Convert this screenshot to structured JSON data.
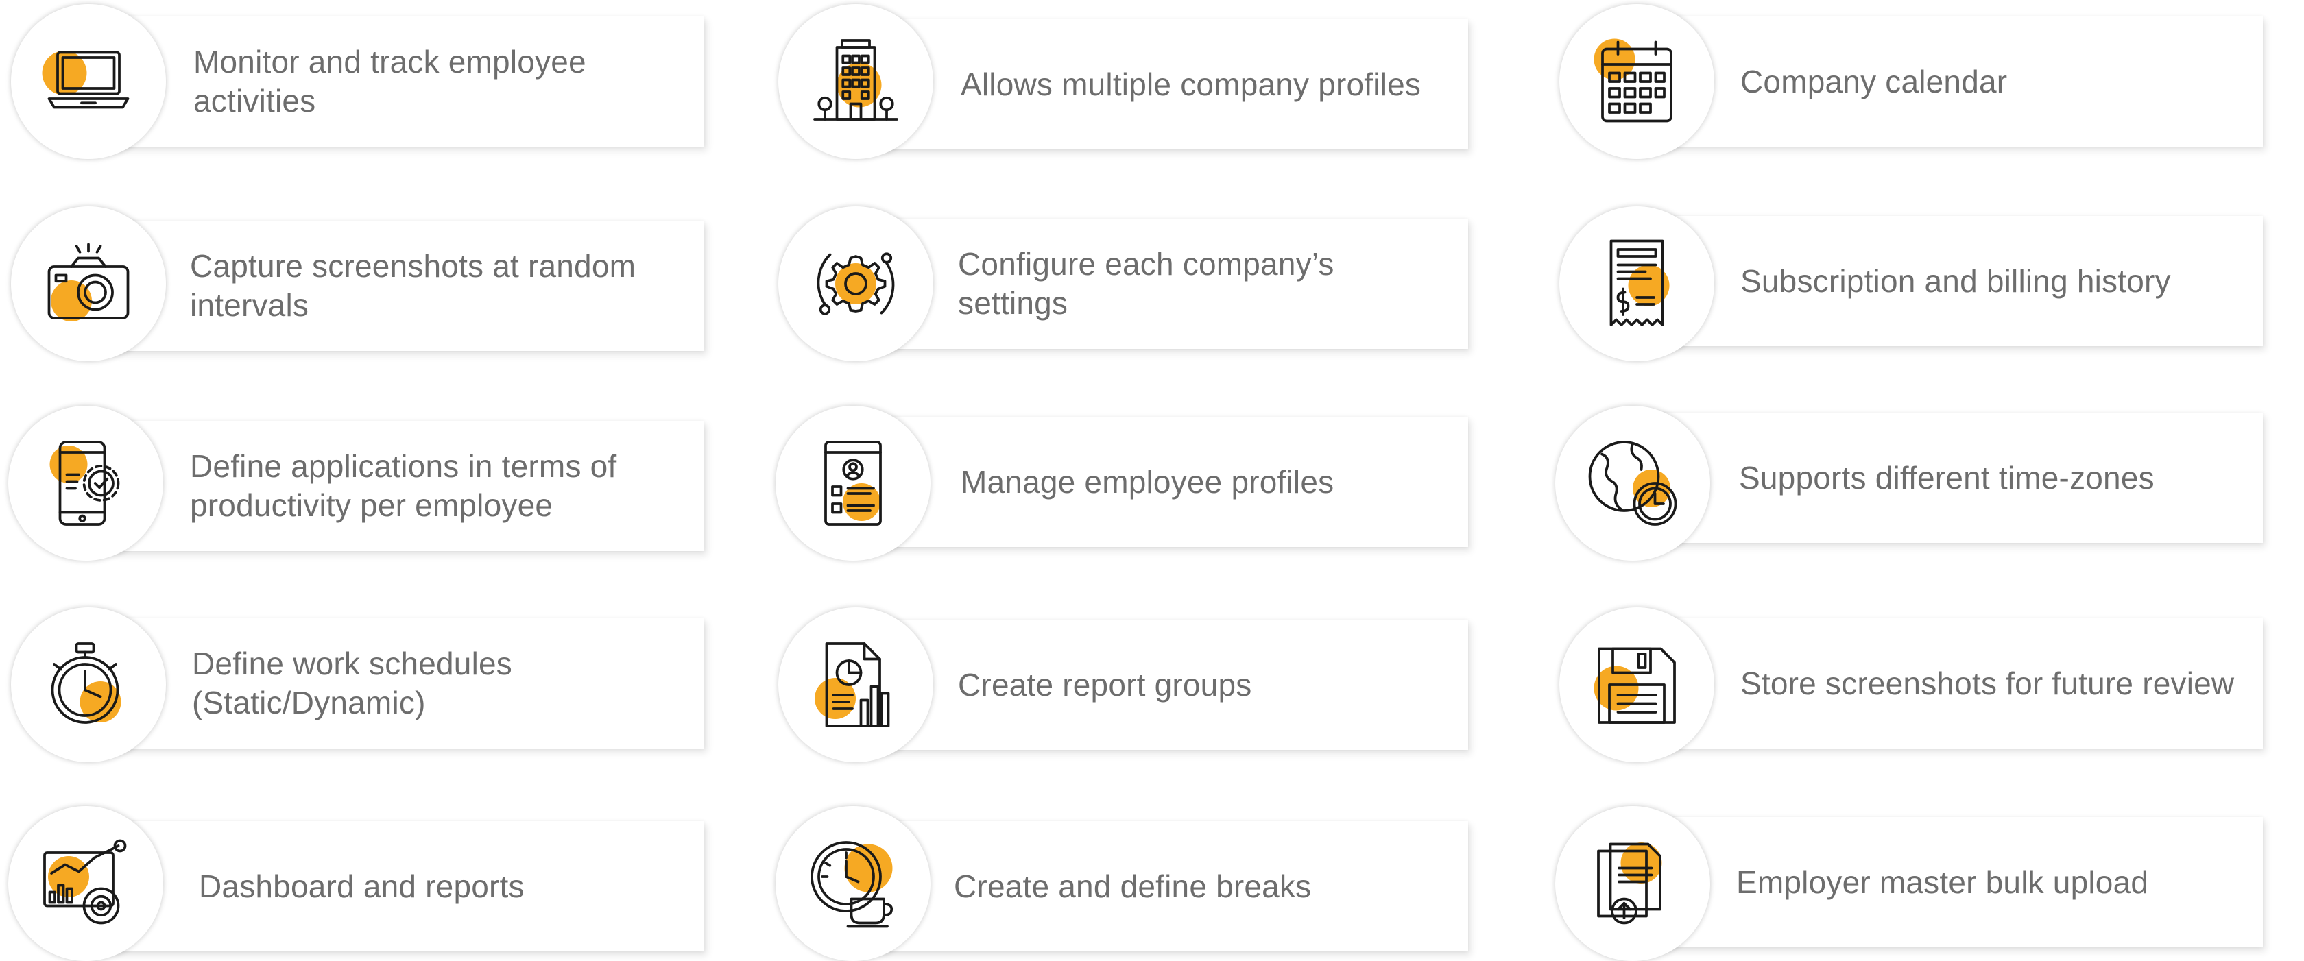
{
  "accent_color": "#f6a923",
  "features": [
    {
      "label": "Monitor and track employee activities",
      "icon": "laptop-icon"
    },
    {
      "label": "Allows multiple company profiles",
      "icon": "building-icon"
    },
    {
      "label": "Company calendar",
      "icon": "calendar-icon"
    },
    {
      "label": "Capture screenshots at random intervals",
      "icon": "camera-icon"
    },
    {
      "label": "Configure each company’s settings",
      "icon": "gear-icon"
    },
    {
      "label": "Subscription and billing history",
      "icon": "receipt-icon"
    },
    {
      "label": "Define applications in terms of productivity per employee",
      "icon": "mobile-settings-icon"
    },
    {
      "label": "Manage employee profiles",
      "icon": "profile-document-icon"
    },
    {
      "label": "Supports different time-zones",
      "icon": "globe-clock-icon"
    },
    {
      "label": "Define work schedules (Static/Dynamic)",
      "icon": "stopwatch-icon"
    },
    {
      "label": "Create report groups",
      "icon": "report-icon"
    },
    {
      "label": "Store screenshots for future review",
      "icon": "floppy-disk-icon"
    },
    {
      "label": "Dashboard and reports",
      "icon": "dashboard-icon"
    },
    {
      "label": "Create and define breaks",
      "icon": "clock-cup-icon"
    },
    {
      "label": "Employer master bulk upload",
      "icon": "upload-document-icon"
    }
  ]
}
